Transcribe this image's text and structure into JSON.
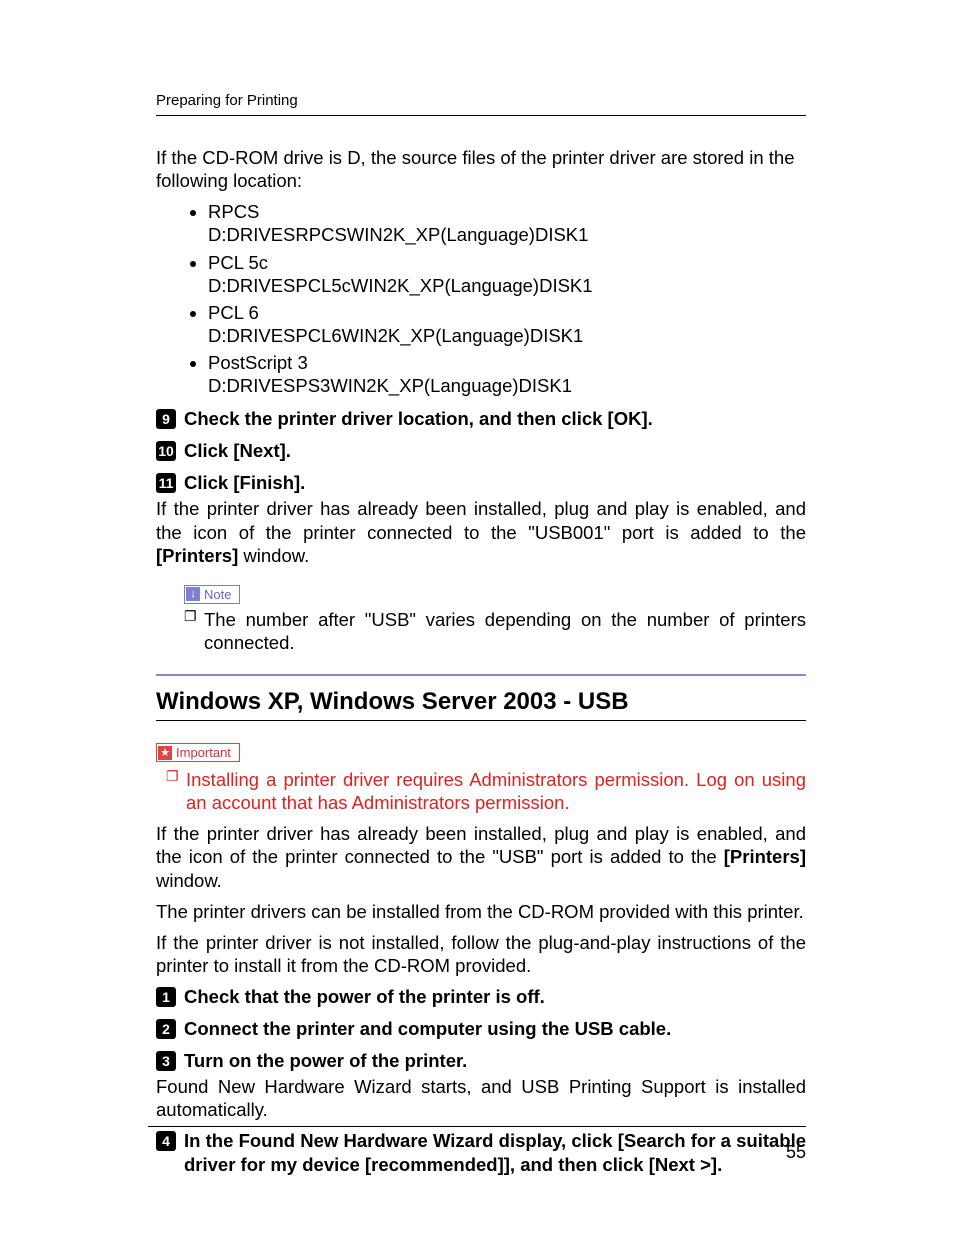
{
  "header": {
    "section": "Preparing for Printing"
  },
  "intro_para": "If the CD-ROM drive is D, the source files of the printer driver are stored in the following location:",
  "drivers": [
    {
      "name": "RPCS",
      "path": "D:DRIVESRPCSWIN2K_XP(Language)DISK1"
    },
    {
      "name": "PCL 5c",
      "path": "D:DRIVESPCL5cWIN2K_XP(Language)DISK1"
    },
    {
      "name": "PCL 6",
      "path": "D:DRIVESPCL6WIN2K_XP(Language)DISK1"
    },
    {
      "name": "PostScript 3",
      "path": "D:DRIVESPS3WIN2K_XP(Language)DISK1"
    }
  ],
  "step9": {
    "num": "9",
    "pre": "Check the printer driver location, and then click [",
    "btn": "OK",
    "post": "]."
  },
  "step10": {
    "num": "10",
    "pre": "Click [",
    "btn": "Next",
    "post": "]."
  },
  "step11": {
    "num": "11",
    "pre": "Click [",
    "btn": "Finish",
    "post": "]."
  },
  "after11_pre": "If the printer driver has already been installed, plug and play is enabled, and the icon of the printer connected to the \"USB001\" port is added to the ",
  "after11_btn": "[Printers]",
  "after11_post": " window.",
  "note_label": "Note",
  "note_item": "The number after \"USB\" varies depending on the number of printers connected.",
  "section_title": "Windows XP, Windows Server 2003 - USB",
  "important_label": "Important",
  "important_item": "Installing a printer driver requires Administrators permission. Log on using an account that has Administrators permission.",
  "xp_para1_pre": "If the printer driver has already been installed, plug and play is enabled, and the icon of the printer connected to the \"USB\" port is added to the ",
  "xp_para1_btn": "[Printers]",
  "xp_para1_post": " window.",
  "xp_para2": "The printer drivers can be installed from the CD-ROM provided with this printer.",
  "xp_para3": "If the printer driver is not installed, follow the plug-and-play instructions of the printer to install it from the CD-ROM provided.",
  "xp_step1": {
    "num": "1",
    "text": "Check that the power of the printer is off."
  },
  "xp_step2": {
    "num": "2",
    "text": "Connect the printer and computer using the USB cable."
  },
  "xp_step3": {
    "num": "3",
    "text": "Turn on the power of the printer."
  },
  "xp_step3_body": "Found New Hardware Wizard starts, and USB Printing Support is installed automatically.",
  "xp_step4": {
    "num": "4",
    "pre": "In the Found New Hardware Wizard display, click [",
    "btn1": "Search for a suitable driver for my device [recommended]",
    "mid": "], and then click [",
    "btn2": "Next >",
    "post": "]."
  },
  "page_number": "55"
}
